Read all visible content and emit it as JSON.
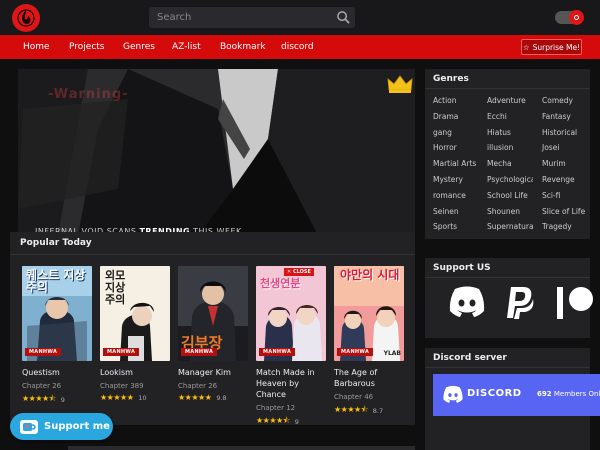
{
  "search": {
    "placeholder": "Search"
  },
  "nav": {
    "items": [
      "Home",
      "Projects",
      "Genres",
      "AZ-list",
      "Bookmark",
      "discord"
    ],
    "surprise_label": "Surprise Me!"
  },
  "hero": {
    "overlay_text": "-Warning-",
    "caption_prefix": "INFERNAL VOID SCANS",
    "caption_bold": "TRENDING",
    "caption_suffix": "THIS WEEK"
  },
  "popular": {
    "title": "Popular Today",
    "items": [
      {
        "title": "Questism",
        "chapter": "Chapter 26",
        "score": "9",
        "badge": "MANHWA",
        "cover_text": "퀘스트 지상주의",
        "stars": 4.5
      },
      {
        "title": "Lookism",
        "chapter": "Chapter 389",
        "score": "10",
        "badge": "MANHWA",
        "cover_text": "외모 지상 주의",
        "stars": 5
      },
      {
        "title": "Manager Kim",
        "chapter": "Chapter 26",
        "score": "9.8",
        "badge": "MANHWA",
        "cover_text": "김부장",
        "stars": 5
      },
      {
        "title": "Match Made in Heaven by Chance",
        "chapter": "Chapter 12",
        "score": "9",
        "badge": "MANHWA",
        "hot": "CLOSE",
        "cover_text": "천생연분",
        "stars": 4.5
      },
      {
        "title": "The Age of Barbarous",
        "chapter": "Chapter 46",
        "score": "8.7",
        "badge": "MANHWA",
        "publisher": "YLAB",
        "cover_text": "야만의 시대",
        "stars": 4.5
      }
    ]
  },
  "support_button": {
    "label": "Support me",
    "ko_icon": "kofi-cup-icon"
  },
  "sidebar": {
    "genres_title": "Genres",
    "genres_col1": [
      "Action",
      "Drama",
      "gang",
      "Horror",
      "Martial Arts",
      "Mystery",
      "romance",
      "Seinen",
      "Sports"
    ],
    "genres_col2": [
      "Adventure",
      "Ecchi",
      "Hiatus",
      "illusion",
      "Mecha",
      "Psychological",
      "School Life",
      "Shounen",
      "Supernatural"
    ],
    "genres_col3": [
      "Comedy",
      "Fantasy",
      "Historical",
      "Josei",
      "Murim",
      "Revenge",
      "Sci-fi",
      "Slice of Life",
      "Tragedy"
    ],
    "support_title": "Support US",
    "support_icons": [
      "discord-icon",
      "paypal-icon",
      "patreon-icon"
    ],
    "discord_title": "Discord server",
    "discord_label": "DISCORD",
    "discord_count": "692",
    "discord_suffix": "Members Onli"
  },
  "colors": {
    "accent": "#d50b0b",
    "panel": "#222224",
    "discord": "#5865f2",
    "star": "#ffc107"
  }
}
